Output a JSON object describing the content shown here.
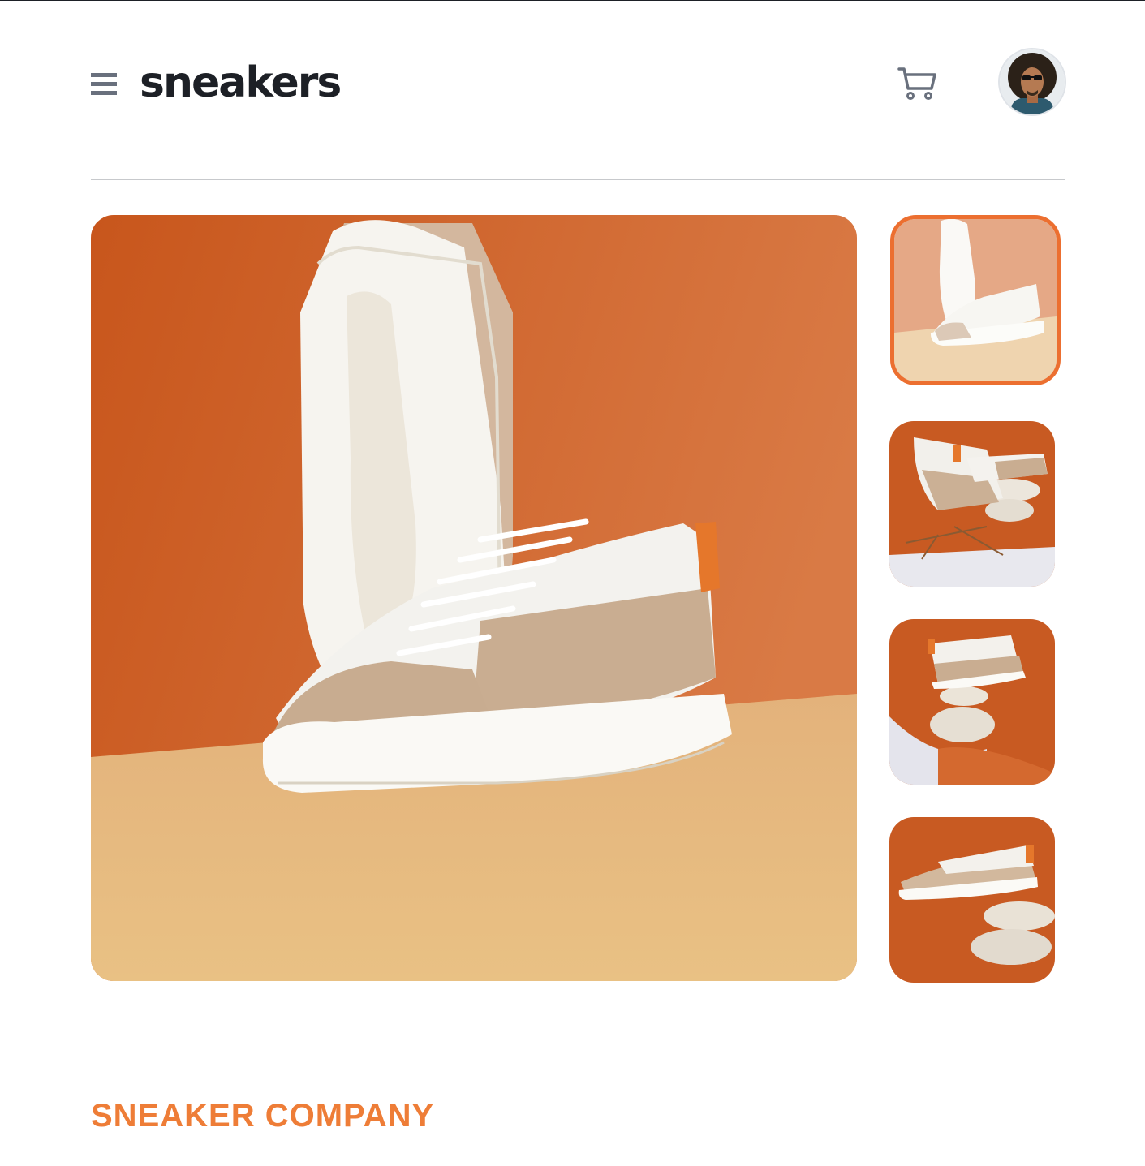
{
  "header": {
    "logo": "sneakers",
    "menu_icon": "hamburger-menu-icon",
    "cart_icon": "cart-icon",
    "avatar_icon": "user-avatar"
  },
  "gallery": {
    "main_image": "product-image-1",
    "thumbnails": [
      {
        "name": "product-thumbnail-1",
        "active": true
      },
      {
        "name": "product-thumbnail-2",
        "active": false
      },
      {
        "name": "product-thumbnail-3",
        "active": false
      },
      {
        "name": "product-thumbnail-4",
        "active": false
      }
    ]
  },
  "product": {
    "company": "SNEAKER COMPANY"
  },
  "colors": {
    "accent": "#ec6f30",
    "company_text": "#ee7d37",
    "logo_text": "#1d2026",
    "icon_gray": "#69707d",
    "divider": "#c7c9cc"
  }
}
